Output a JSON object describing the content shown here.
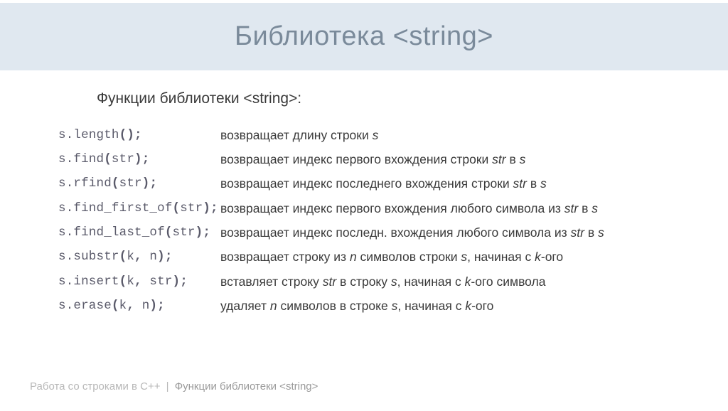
{
  "title": "Библиотека <string>",
  "subtitle": "Функции библиотеки <string>:",
  "rows": [
    {
      "code": "s.length();",
      "desc": "возвращает длину строки ",
      "tail": "s",
      "tail_it": true
    },
    {
      "code": "s.find(str);",
      "desc": "возвращает индекс первого вхождения строки ",
      "mid_it": "str",
      "mid2": " в ",
      "tail": "s",
      "tail_it": true
    },
    {
      "code": "s.rfind(str);",
      "desc": "возвращает индекс последнего вхождения строки ",
      "mid_it": "str",
      "mid2": " в ",
      "tail": "s",
      "tail_it": true
    },
    {
      "code": "s.find_first_of(str);",
      "desc": "возвращает индекс первого вхождения любого символа из ",
      "mid_it": "str",
      "mid2": " в ",
      "tail": "s",
      "tail_it": true
    },
    {
      "code": "s.find_last_of(str);",
      "desc": "возвращает индекс последн. вхождения любого символа из ",
      "mid_it": "str",
      "mid2": " в ",
      "tail": "s",
      "tail_it": true
    },
    {
      "code": "s.substr(k, n);",
      "desc": "возвращает строку из ",
      "mid_it": "n",
      "mid2": " символов строки ",
      "mid_it2": "s",
      "mid3": ", начиная с ",
      "tail": "k",
      "tail_it": true,
      "suffix": "-ого"
    },
    {
      "code": "s.insert(k, str);",
      "desc": "вставляет строку ",
      "mid_it": "str",
      "mid2": " в строку ",
      "mid_it2": "s",
      "mid3": ", начиная с ",
      "tail": "k",
      "tail_it": true,
      "suffix": "-ого символа"
    },
    {
      "code": "s.erase(k, n);",
      "desc": "удаляет ",
      "mid_it": "n",
      "mid2": " символов в строке ",
      "mid_it2": "s",
      "mid3": ", начиная с ",
      "tail": "k",
      "tail_it": true,
      "suffix": "-ого"
    }
  ],
  "footer": {
    "part1": "Работа со строками в C++",
    "sep": "|",
    "part2": "Функции библиотеки <string>"
  }
}
